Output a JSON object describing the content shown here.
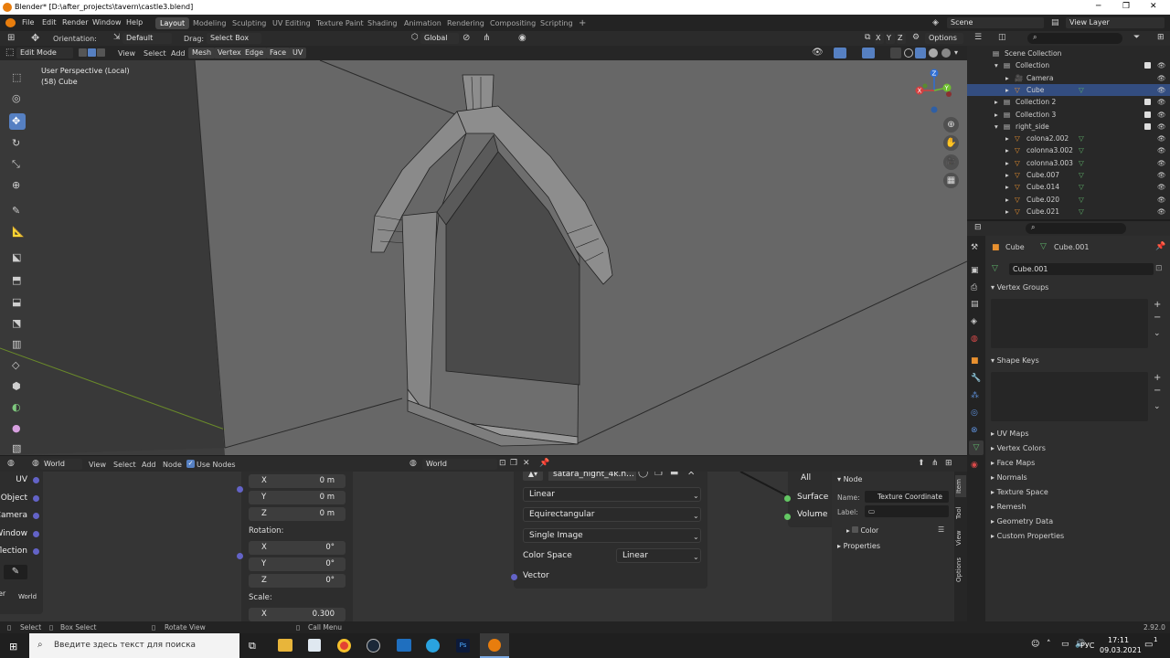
{
  "titlebar": {
    "title": "Blender* [D:\\after_projects\\tavern\\castle3.blend]"
  },
  "menubar": {
    "menus": [
      "File",
      "Edit",
      "Render",
      "Window",
      "Help"
    ],
    "workspaces": [
      "Layout",
      "Modeling",
      "Sculpting",
      "UV Editing",
      "Texture Paint",
      "Shading",
      "Animation",
      "Rendering",
      "Compositing",
      "Scripting"
    ],
    "active_workspace": "Layout",
    "add_tab": "+",
    "scene": "Scene",
    "view_layer": "View Layer"
  },
  "header3d": {
    "orientation_label": "Orientation:",
    "orientation_value": "Default",
    "drag_label": "Drag:",
    "drag_value": "Select Box",
    "transform_value": "Global",
    "axes": [
      "X",
      "Y",
      "Z"
    ],
    "options": "Options"
  },
  "header3d_menus": {
    "mode": "Edit Mode",
    "items": [
      "View",
      "Select",
      "Add",
      "Mesh",
      "Vertex",
      "Edge",
      "Face",
      "UV"
    ]
  },
  "viewport": {
    "view_name": "User Perspective (Local)",
    "object_info": "(58) Cube"
  },
  "gizmo": {
    "x": "X",
    "y": "Y",
    "z": "Z"
  },
  "outliner": {
    "rows": [
      {
        "label": "Scene Collection",
        "indent": 0
      },
      {
        "label": "Collection",
        "indent": 1
      },
      {
        "label": "Camera",
        "indent": 2
      },
      {
        "label": "Cube",
        "indent": 2,
        "selected": true
      },
      {
        "label": "Collection 2",
        "indent": 1
      },
      {
        "label": "Collection 3",
        "indent": 1
      },
      {
        "label": "right_side",
        "indent": 1
      },
      {
        "label": "colona2.002",
        "indent": 2
      },
      {
        "label": "colonna3.002",
        "indent": 2
      },
      {
        "label": "colonna3.003",
        "indent": 2
      },
      {
        "label": "Cube.007",
        "indent": 2
      },
      {
        "label": "Cube.014",
        "indent": 2
      },
      {
        "label": "Cube.020",
        "indent": 2
      },
      {
        "label": "Cube.021",
        "indent": 2
      }
    ]
  },
  "properties": {
    "breadcrumb_object": "Cube",
    "breadcrumb_mesh": "Cube.001",
    "mesh_name": "Cube.001",
    "sections": [
      "Vertex Groups",
      "Shape Keys"
    ],
    "collapsed": [
      "UV Maps",
      "Vertex Colors",
      "Face Maps",
      "Normals",
      "Texture Space",
      "Remesh",
      "Geometry Data",
      "Custom Properties"
    ]
  },
  "nodehdr": {
    "type": "World",
    "items": [
      "View",
      "Select",
      "Add",
      "Node"
    ],
    "use_nodes": "Use Nodes",
    "world_name": "World"
  },
  "nodes": {
    "texcoord_outputs": [
      "UV",
      "Object",
      "Camera",
      "Window",
      "flection"
    ],
    "texcoord_bottom": "World",
    "texcoord_er": "er",
    "mapping_loc": [
      {
        "axis": "X",
        "value": "0 m"
      },
      {
        "axis": "Y",
        "value": "0 m"
      },
      {
        "axis": "Z",
        "value": "0 m"
      }
    ],
    "rotation_label": "Rotation:",
    "mapping_rot": [
      {
        "axis": "X",
        "value": "0°"
      },
      {
        "axis": "Y",
        "value": "0°"
      },
      {
        "axis": "Z",
        "value": "0°"
      }
    ],
    "scale_label": "Scale:",
    "mapping_scale": [
      {
        "axis": "X",
        "value": "0.300"
      }
    ],
    "env_image": "satara_night_4k.h...",
    "interpolation": "Linear",
    "projection": "Equirectangular",
    "source": "Single Image",
    "color_space_label": "Color Space",
    "color_space": "Linear",
    "vector_label": "Vector",
    "output_all": "All",
    "output_surface": "Surface",
    "output_volume": "Volume"
  },
  "node_sidebar": {
    "section": "Node",
    "name_label": "Name:",
    "name_value": "Texture Coordinate",
    "label_label": "Label:",
    "color": "Color",
    "properties": "Properties",
    "tabs": [
      "Item",
      "Tool",
      "View",
      "Options"
    ]
  },
  "statusbar": {
    "items": [
      "Select",
      "Box Select",
      "Rotate View",
      "Call Menu"
    ],
    "version": "2.92.0"
  },
  "taskbar": {
    "search_placeholder": "Введите здесь текст для поиска",
    "lang": "РУС",
    "time": "17:11",
    "date": "09.03.2021",
    "notify": "1"
  },
  "colors": {
    "accent": "#5680c2",
    "selected_row": "#334d80",
    "socket_purple": "#6363c7",
    "socket_green": "#63c763",
    "socket_yellow": "#c7c729",
    "object_orange": "#e8902f",
    "mesh_green": "#5fb26a"
  }
}
